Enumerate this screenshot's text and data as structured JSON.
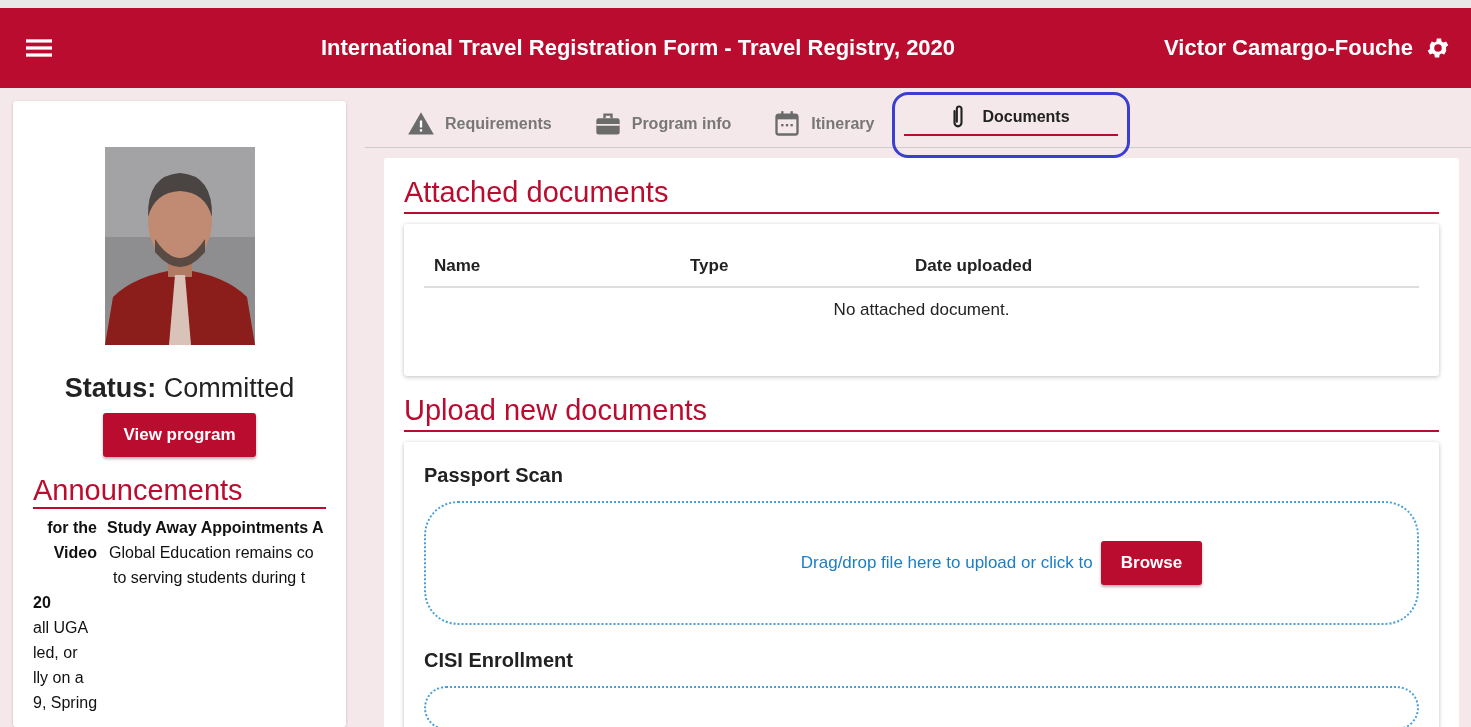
{
  "header": {
    "title": "International Travel Registration Form - Travel Registry, 2020",
    "user": "Victor Camargo-Fouche"
  },
  "profile": {
    "status_label": "Status:",
    "status": "Committed",
    "button": "View program"
  },
  "announcements": {
    "title": "Announcements",
    "items": [
      {
        "lines": [
          {
            "text": "for the",
            "bold": true
          },
          {
            "text": "Video",
            "bold": true
          },
          {
            "text": "20",
            "bold": true,
            "gap": true
          },
          {
            "text": "all UGA",
            "bold": false
          },
          {
            "text": "led, or",
            "bold": false
          },
          {
            "text": "lly on a",
            "bold": false
          },
          {
            "text": "9, Spring",
            "bold": false
          }
        ]
      },
      {
        "lines": [
          {
            "text": "Study Away Appointments A",
            "bold": true
          },
          {
            "text": "Global Education remains co",
            "bold": false
          },
          {
            "text": "to serving students during t",
            "bold": false
          }
        ]
      }
    ]
  },
  "tabs": [
    {
      "label": "Requirements",
      "selected": false,
      "highlighted": false
    },
    {
      "label": "Program info",
      "selected": false,
      "highlighted": false
    },
    {
      "label": "Itinerary",
      "selected": false,
      "highlighted": false
    },
    {
      "label": "Documents",
      "selected": true,
      "highlighted": true
    }
  ],
  "attached": {
    "title": "Attached documents",
    "columns": [
      "Name",
      "Type",
      "Date uploaded"
    ],
    "empty": "No attached document."
  },
  "upload": {
    "title": "Upload new documents",
    "items": [
      {
        "label": "Passport Scan",
        "hint": "Drag/drop file here to upload or click to",
        "button": "Browse"
      },
      {
        "label": "CISI Enrollment"
      }
    ]
  }
}
